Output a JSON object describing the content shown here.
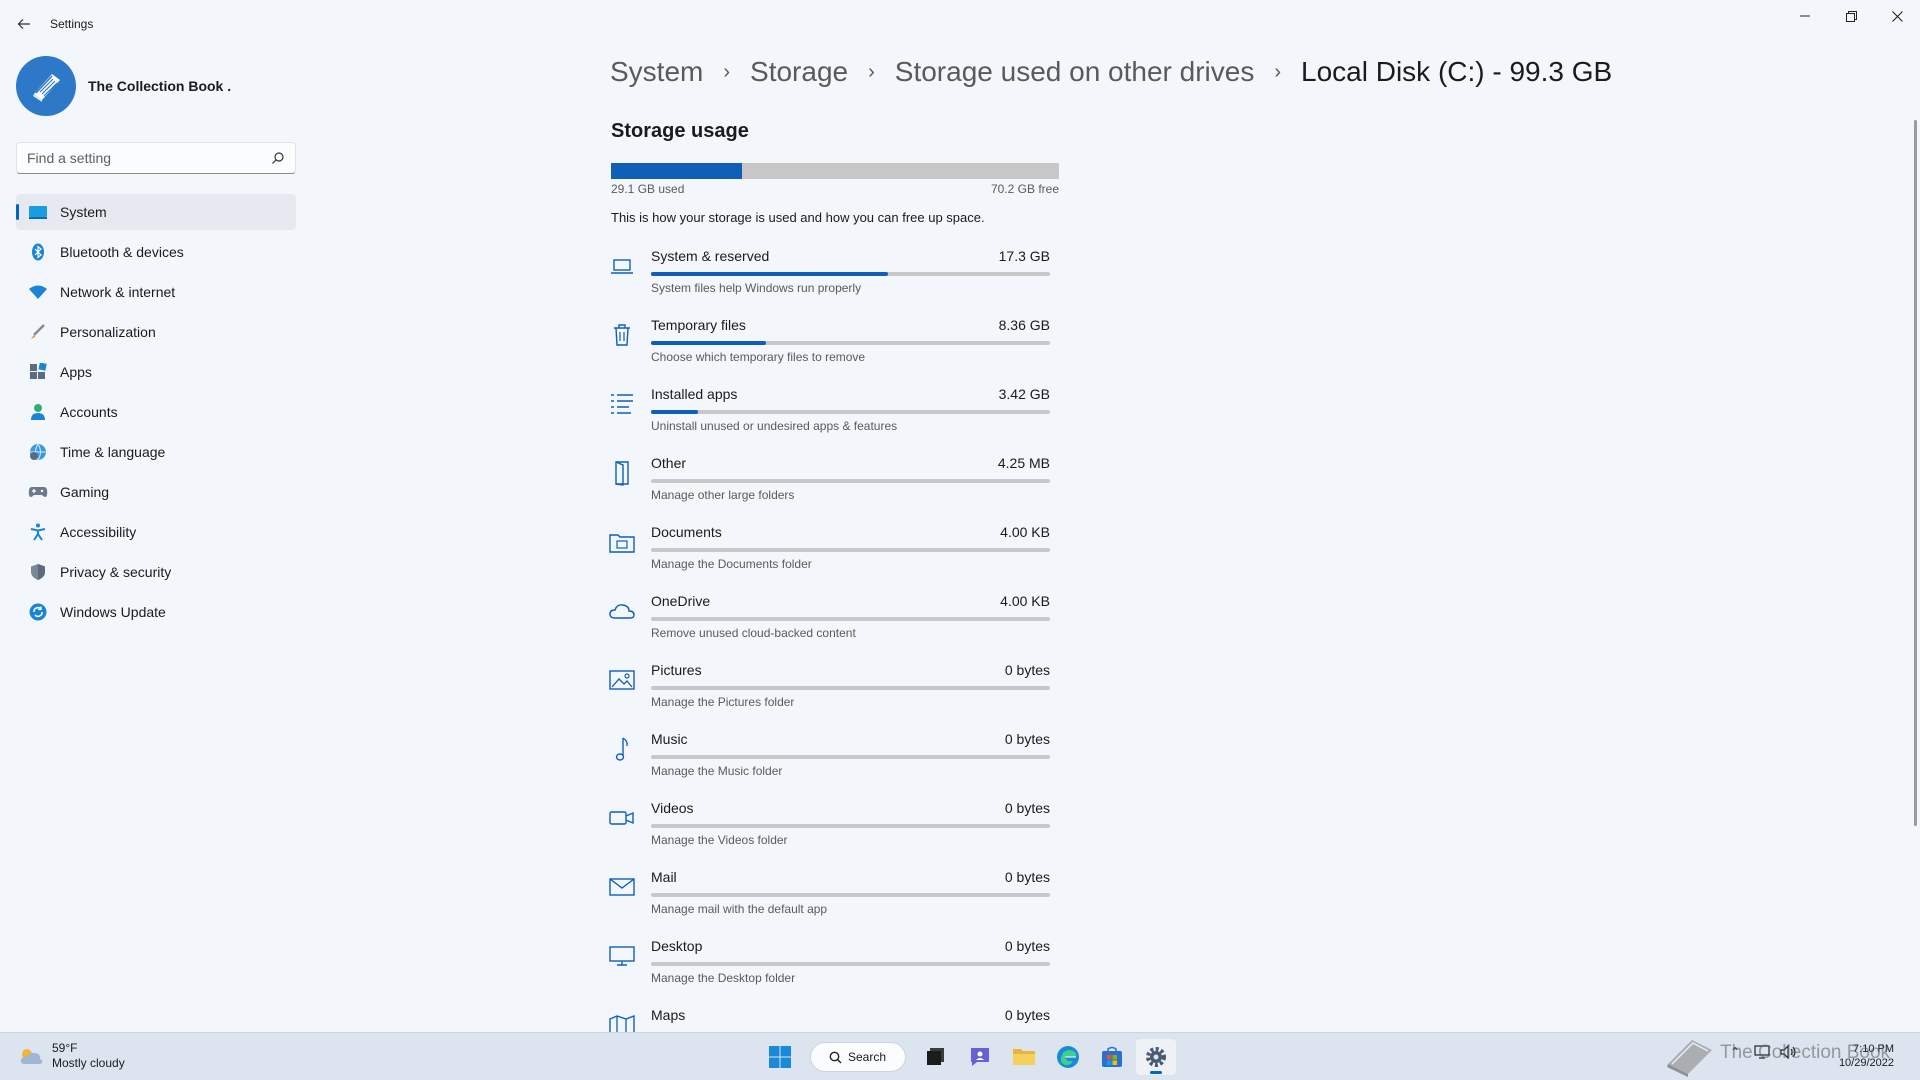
{
  "app": {
    "title": "Settings"
  },
  "profile": {
    "name": "The Collection Book ."
  },
  "search": {
    "placeholder": "Find a setting"
  },
  "sidebar": {
    "items": [
      {
        "label": "System",
        "icon": "system-icon",
        "active": true
      },
      {
        "label": "Bluetooth & devices",
        "icon": "bluetooth-icon"
      },
      {
        "label": "Network & internet",
        "icon": "wifi-icon"
      },
      {
        "label": "Personalization",
        "icon": "brush-icon"
      },
      {
        "label": "Apps",
        "icon": "apps-icon"
      },
      {
        "label": "Accounts",
        "icon": "person-icon"
      },
      {
        "label": "Time & language",
        "icon": "globe-clock-icon"
      },
      {
        "label": "Gaming",
        "icon": "gamepad-icon"
      },
      {
        "label": "Accessibility",
        "icon": "accessibility-icon"
      },
      {
        "label": "Privacy & security",
        "icon": "shield-icon"
      },
      {
        "label": "Windows Update",
        "icon": "update-icon"
      }
    ]
  },
  "breadcrumb": {
    "items": [
      "System",
      "Storage",
      "Storage used on other drives",
      "Local Disk (C:) - 99.3 GB"
    ]
  },
  "storage": {
    "title": "Storage usage",
    "used_label": "29.1 GB used",
    "free_label": "70.2 GB free",
    "used_fraction": 0.293,
    "description": "This is how your storage is used and how you can free up space.",
    "categories": [
      {
        "name": "System & reserved",
        "size": "17.3 GB",
        "desc": "System files help Windows run properly",
        "icon": "laptop-icon",
        "fraction": 0.595
      },
      {
        "name": "Temporary files",
        "size": "8.36 GB",
        "desc": "Choose which temporary files to remove",
        "icon": "trash-icon",
        "fraction": 0.287
      },
      {
        "name": "Installed apps",
        "size": "3.42 GB",
        "desc": "Uninstall unused or undesired apps & features",
        "icon": "list-icon",
        "fraction": 0.118
      },
      {
        "name": "Other",
        "size": "4.25 MB",
        "desc": "Manage other large folders",
        "icon": "door-icon",
        "fraction": 0
      },
      {
        "name": "Documents",
        "size": "4.00 KB",
        "desc": "Manage the Documents folder",
        "icon": "documents-icon",
        "fraction": 0
      },
      {
        "name": "OneDrive",
        "size": "4.00 KB",
        "desc": "Remove unused cloud-backed content",
        "icon": "cloud-icon",
        "fraction": 0
      },
      {
        "name": "Pictures",
        "size": "0 bytes",
        "desc": "Manage the Pictures folder",
        "icon": "picture-icon",
        "fraction": 0
      },
      {
        "name": "Music",
        "size": "0 bytes",
        "desc": "Manage the Music folder",
        "icon": "music-icon",
        "fraction": 0
      },
      {
        "name": "Videos",
        "size": "0 bytes",
        "desc": "Manage the Videos folder",
        "icon": "video-icon",
        "fraction": 0
      },
      {
        "name": "Mail",
        "size": "0 bytes",
        "desc": "Manage mail with the default app",
        "icon": "mail-icon",
        "fraction": 0
      },
      {
        "name": "Desktop",
        "size": "0 bytes",
        "desc": "Manage the Desktop folder",
        "icon": "monitor-icon",
        "fraction": 0
      },
      {
        "name": "Maps",
        "size": "0 bytes",
        "desc": "",
        "icon": "map-icon",
        "fraction": 0
      }
    ]
  },
  "taskbar": {
    "weather": {
      "temp": "59°F",
      "condition": "Mostly cloudy"
    },
    "search_label": "Search",
    "time": "7:10 PM",
    "date": "10/29/2022"
  },
  "watermark": {
    "text": "The Collection Book"
  },
  "colors": {
    "accent": "#0f5fb8",
    "background": "#f3f6fb",
    "taskbar": "#dce4ef"
  }
}
